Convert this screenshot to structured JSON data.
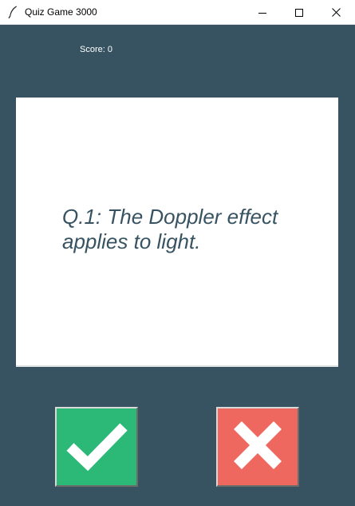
{
  "window": {
    "title": "Quiz Game 3000",
    "icon": "feather-icon",
    "controls": [
      "minimize-icon",
      "maximize-icon",
      "close-icon"
    ]
  },
  "score": {
    "label": "Score: 0"
  },
  "card": {
    "question": "Q.1: The Doppler effect applies to light."
  },
  "buttons": {
    "true_icon": "checkmark-icon",
    "false_icon": "cross-icon"
  },
  "colors": {
    "background": "#375362",
    "card": "#ffffff",
    "question_text": "#375362",
    "true_button": "#2cb978",
    "false_button": "#ee6860"
  }
}
